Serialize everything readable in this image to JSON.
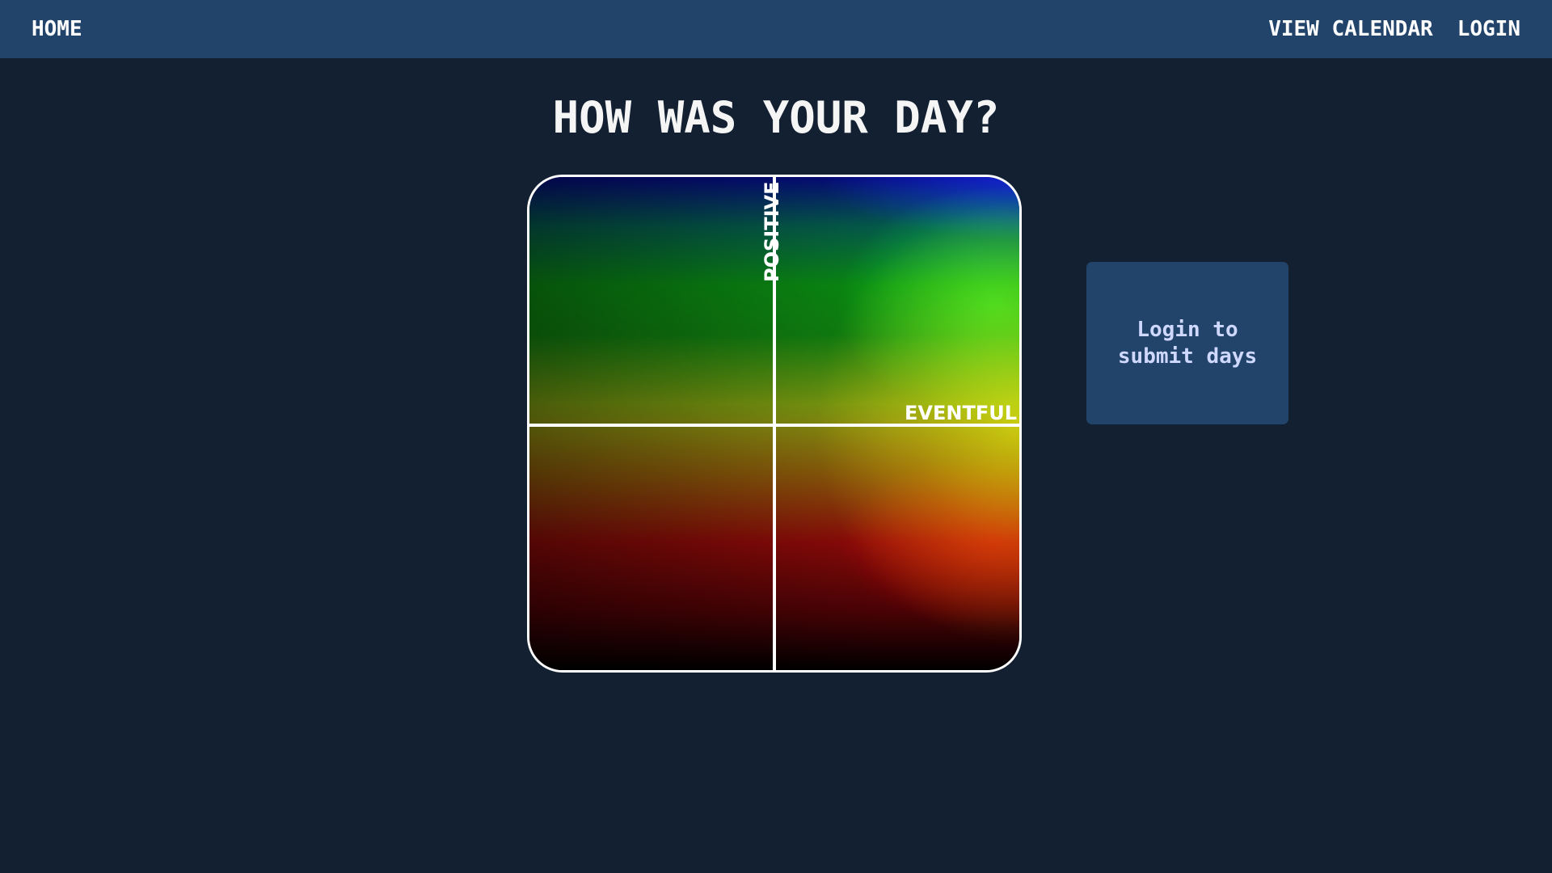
{
  "nav": {
    "home_label": "HOME",
    "view_calendar_label": "VIEW CALENDAR",
    "login_label": "LOGIN"
  },
  "page": {
    "title": "HOW WAS YOUR DAY?"
  },
  "mood_grid": {
    "y_axis_label": "POSITIVE",
    "x_axis_label": "EVENTFUL"
  },
  "login_card": {
    "text": "Login to submit days"
  },
  "colors": {
    "background": "#122031",
    "navbar": "#23446a",
    "card": "#23446a",
    "card_text": "#cfd8ff",
    "text": "#ffffff"
  }
}
